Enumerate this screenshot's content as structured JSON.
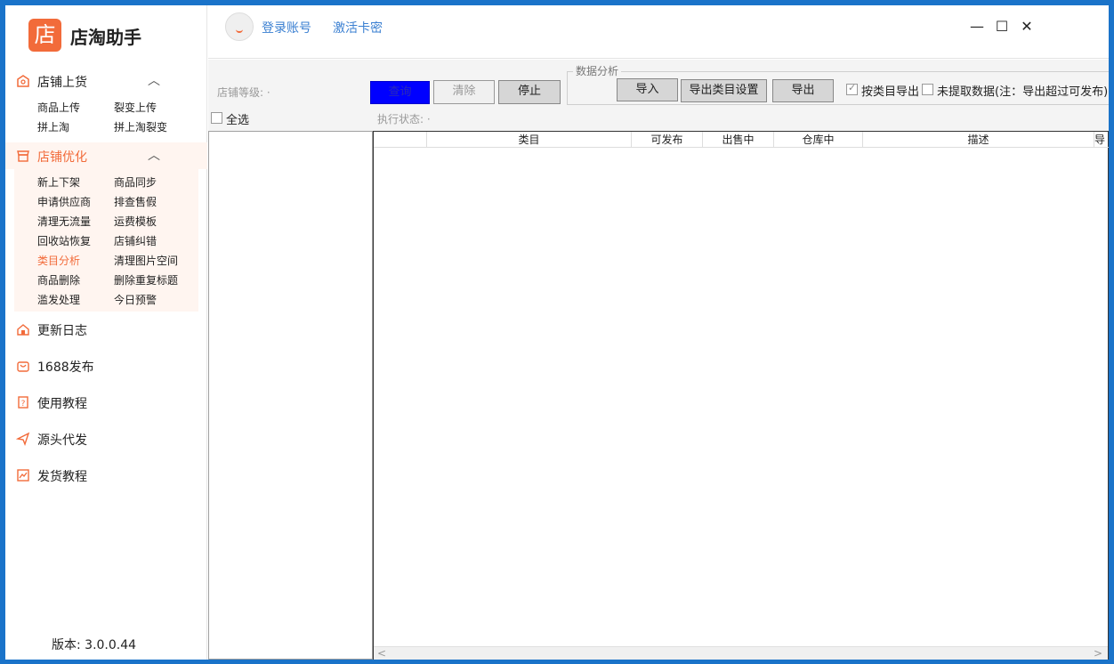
{
  "app": {
    "logo_char": "店",
    "name": "店淘助手",
    "version": "版本: 3.0.0.44"
  },
  "sidebar": {
    "sections": [
      {
        "label": "店铺上货",
        "icon": "store-icon",
        "chevron": "︿",
        "items": [
          "商品上传",
          "裂变上传",
          "拼上淘",
          "拼上淘裂变"
        ]
      },
      {
        "label": "店铺优化",
        "icon": "shop-optimize-icon",
        "chevron": "︿",
        "items": [
          "新上下架",
          "商品同步",
          "申请供应商",
          "排查售假",
          "清理无流量",
          "运费模板",
          "回收站恢复",
          "店铺纠错",
          "类目分析",
          "清理图片空间",
          "商品删除",
          "删除重复标题",
          "滥发处理",
          "今日预警"
        ],
        "selected": "类目分析"
      }
    ],
    "nav": [
      {
        "label": "更新日志",
        "icon": "log-icon"
      },
      {
        "label": "1688发布",
        "icon": "bag-icon"
      },
      {
        "label": "使用教程",
        "icon": "tutorial-icon"
      },
      {
        "label": "源头代发",
        "icon": "send-icon"
      },
      {
        "label": "发货教程",
        "icon": "chart-icon"
      }
    ]
  },
  "topbar": {
    "login": "登录账号",
    "activate": "激活卡密",
    "minimize": "—",
    "maximize": "☐",
    "close": "✕"
  },
  "toolbar": {
    "store_level_label": "店铺等级: ·",
    "query": "查询",
    "clear": "清除",
    "stop": "停止",
    "group_title": "数据分析",
    "import": "导入",
    "export_settings": "导出类目设置",
    "export": "导出",
    "export_by_category": "按类目导出",
    "export_by_category_checked": true,
    "unfetched_data": "未提取数据(注：导出超过可发布)",
    "unfetched_data_checked": false,
    "select_all": "全选",
    "status_label": "执行状态: ·"
  },
  "table": {
    "columns": [
      "",
      "类目",
      "可发布",
      "出售中",
      "仓库中",
      "描述",
      "导"
    ],
    "rows": []
  },
  "colors": {
    "accent": "#f26b3a",
    "link": "#3a7fd1",
    "query_button": "#0000ff"
  }
}
